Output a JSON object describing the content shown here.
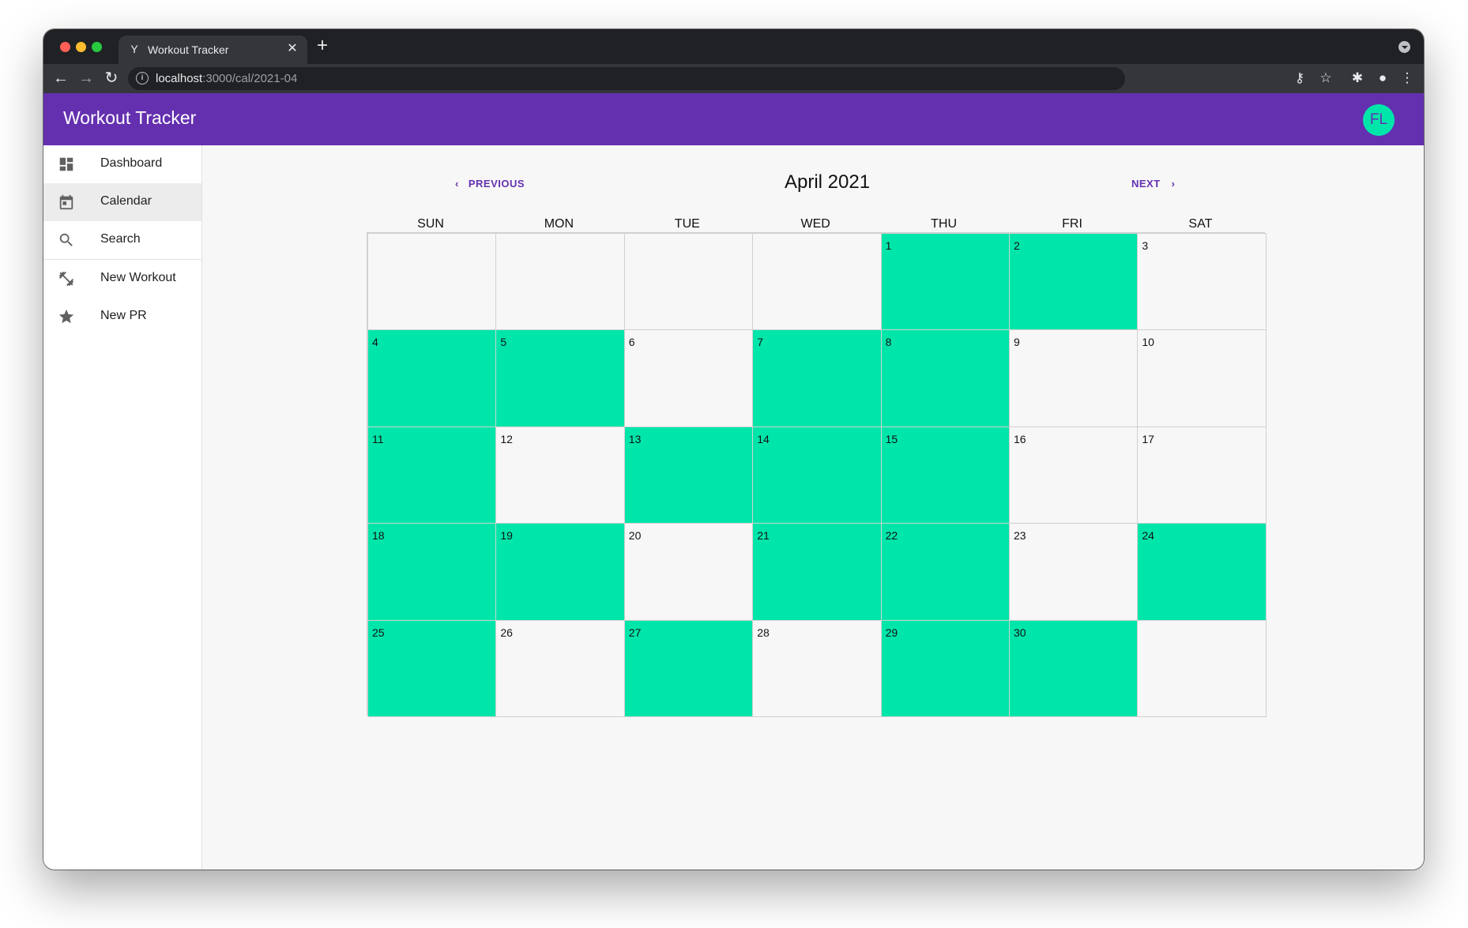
{
  "browser": {
    "tab_title": "Workout Tracker",
    "url_host": "localhost",
    "url_rest": ":3000/cal/2021-04"
  },
  "app": {
    "title": "Workout Tracker",
    "avatar_initials": "FL",
    "colors": {
      "primary": "#6430af",
      "accent": "#00e6aa"
    }
  },
  "sidebar": {
    "items": [
      {
        "label": "Dashboard",
        "icon": "dashboard-icon",
        "active": false
      },
      {
        "label": "Calendar",
        "icon": "calendar-icon",
        "active": true
      },
      {
        "label": "Search",
        "icon": "search-icon",
        "active": false
      },
      {
        "label": "New Workout",
        "icon": "dumbbell-icon",
        "active": false
      },
      {
        "label": "New PR",
        "icon": "star-icon",
        "active": false
      }
    ]
  },
  "calendar": {
    "title": "April 2021",
    "previous_label": "PREVIOUS",
    "next_label": "NEXT",
    "weekdays": [
      "SUN",
      "MON",
      "TUE",
      "WED",
      "THU",
      "FRI",
      "SAT"
    ],
    "first_weekday_index": 4,
    "days_in_month": 30,
    "workout_days": [
      1,
      2,
      4,
      5,
      7,
      8,
      11,
      13,
      14,
      15,
      18,
      19,
      21,
      22,
      24,
      25,
      27,
      29,
      30
    ]
  }
}
